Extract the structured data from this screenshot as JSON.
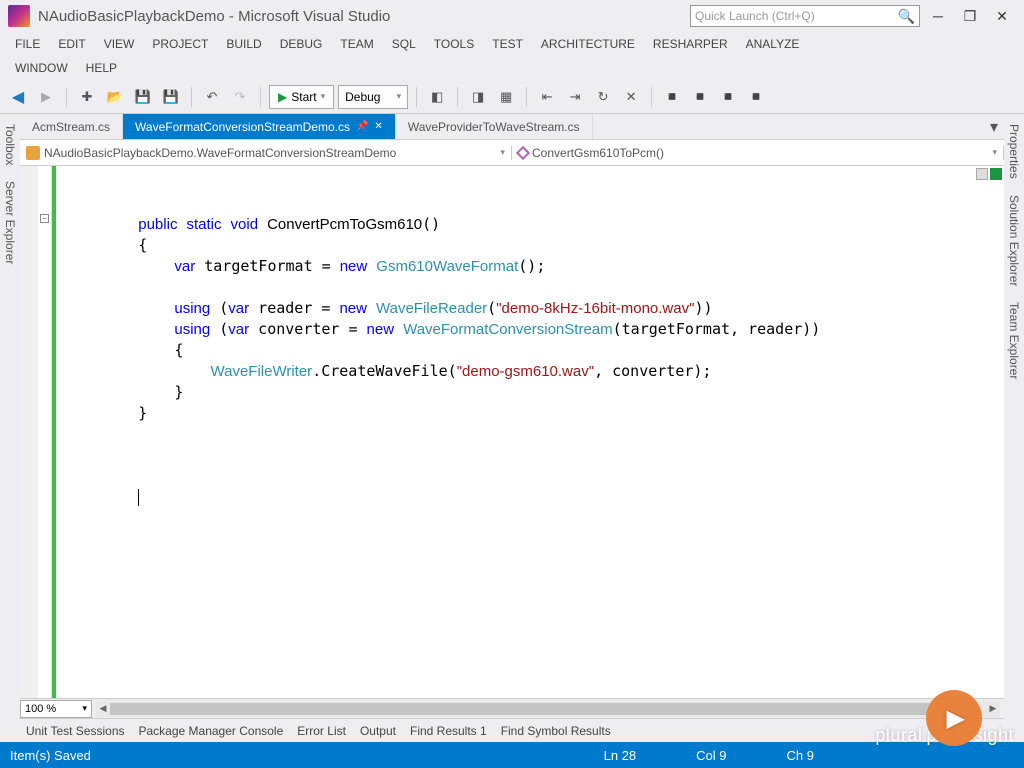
{
  "title": "NAudioBasicPlaybackDemo - Microsoft Visual Studio",
  "quick_launch_placeholder": "Quick Launch (Ctrl+Q)",
  "menu": [
    "FILE",
    "EDIT",
    "VIEW",
    "PROJECT",
    "BUILD",
    "DEBUG",
    "TEAM",
    "SQL",
    "TOOLS",
    "TEST",
    "ARCHITECTURE",
    "RESHARPER",
    "ANALYZE"
  ],
  "menu2": [
    "WINDOW",
    "HELP"
  ],
  "toolbar": {
    "start": "Start",
    "config": "Debug"
  },
  "tabs": [
    {
      "label": "AcmStream.cs",
      "active": false,
      "pinned": false
    },
    {
      "label": "WaveFormatConversionStreamDemo.cs",
      "active": true,
      "pinned": true
    },
    {
      "label": "WaveProviderToWaveStream.cs",
      "active": false,
      "pinned": false
    }
  ],
  "nav": {
    "scope": "NAudioBasicPlaybackDemo.WaveFormatConversionStreamDemo",
    "member": "ConvertGsm610ToPcm()"
  },
  "side_left": [
    "Toolbox",
    "Server Explorer"
  ],
  "side_right": [
    "Properties",
    "Solution Explorer",
    "Team Explorer"
  ],
  "code": {
    "method": "ConvertPcmToGsm610",
    "t_Gsm610WaveFormat": "Gsm610WaveFormat",
    "t_WaveFileReader": "WaveFileReader",
    "t_WaveFormatConversionStream": "WaveFormatConversionStream",
    "t_WaveFileWriter": "WaveFileWriter",
    "str_input": "\"demo-8kHz-16bit-mono.wav\"",
    "str_output": "\"demo-gsm610.wav\""
  },
  "zoom": "100 %",
  "bottom_tabs": [
    "Unit Test Sessions",
    "Package Manager Console",
    "Error List",
    "Output",
    "Find Results 1",
    "Find Symbol Results"
  ],
  "status": {
    "message": "Item(s) Saved",
    "ln": "Ln 28",
    "col": "Col 9",
    "ch": "Ch 9"
  },
  "brand": "pluralsight"
}
